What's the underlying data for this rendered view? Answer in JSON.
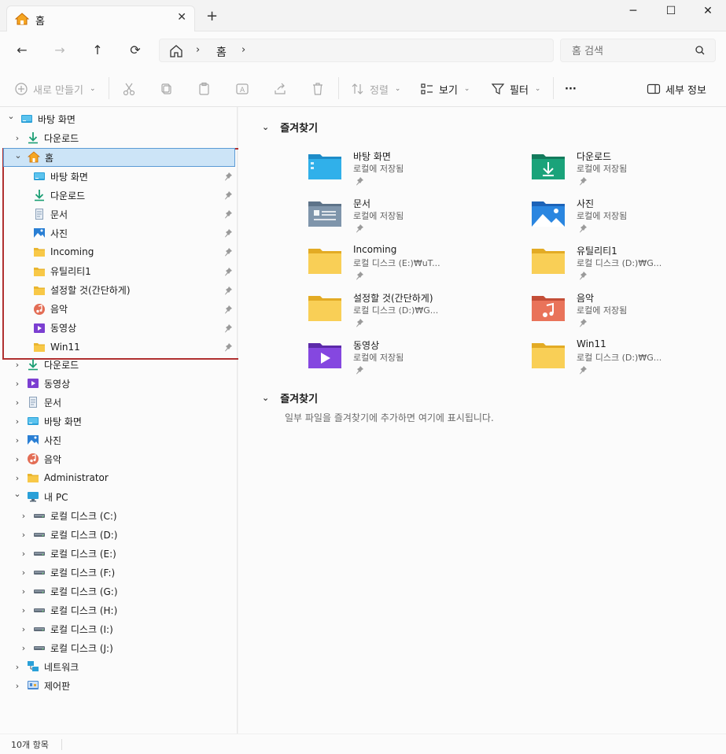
{
  "tab": {
    "title": "홈",
    "close": "✕",
    "new_tab": "+"
  },
  "window": {
    "minimize": "─",
    "maximize": "☐",
    "close": "✕"
  },
  "nav": {
    "back": "←",
    "forward": "→",
    "up": "↑",
    "refresh": "⟳"
  },
  "address": {
    "segment": "홈",
    "chevron": "›"
  },
  "search": {
    "placeholder": "홈 검색"
  },
  "toolbar": {
    "new_label": "새로 만들기",
    "sort_label": "정렬",
    "view_label": "보기",
    "filter_label": "필터",
    "more_label": "···",
    "details_label": "세부 정보"
  },
  "sidebar": {
    "desktop_top": "바탕 화면",
    "downloads_top": "다운로드",
    "home": "홈",
    "home_children": [
      {
        "label": "바탕 화면",
        "icon": "desktop-icon"
      },
      {
        "label": "다운로드",
        "icon": "download-icon"
      },
      {
        "label": "문서",
        "icon": "document-icon"
      },
      {
        "label": "사진",
        "icon": "pictures-icon"
      },
      {
        "label": "Incoming",
        "icon": "folder-icon"
      },
      {
        "label": "유틸리티1",
        "icon": "folder-icon"
      },
      {
        "label": "설정할 것(간단하게)",
        "icon": "folder-icon"
      },
      {
        "label": "음악",
        "icon": "music-icon"
      },
      {
        "label": "동영상",
        "icon": "video-icon"
      },
      {
        "label": "Win11",
        "icon": "folder-icon"
      }
    ],
    "libraries": [
      {
        "label": "다운로드",
        "icon": "download-icon"
      },
      {
        "label": "동영상",
        "icon": "video-icon"
      },
      {
        "label": "문서",
        "icon": "document-icon"
      },
      {
        "label": "바탕 화면",
        "icon": "desktop-icon"
      },
      {
        "label": "사진",
        "icon": "pictures-icon"
      },
      {
        "label": "음악",
        "icon": "music-icon"
      },
      {
        "label": "Administrator",
        "icon": "folder-icon"
      }
    ],
    "pc": "내 PC",
    "drives": [
      "로컬 디스크 (C:)",
      "로컬 디스크 (D:)",
      "로컬 디스크 (E:)",
      "로컬 디스크 (F:)",
      "로컬 디스크 (G:)",
      "로컬 디스크 (H:)",
      "로컬 디스크 (I:)",
      "로컬 디스크 (J:)"
    ],
    "network": "네트워크",
    "control_panel": "제어판"
  },
  "main": {
    "section1": "즐겨찾기",
    "section2": "즐겨찾기",
    "empty_message": "일부 파일을 즐겨찾기에 추가하면 여기에 표시됩니다.",
    "favorites": [
      {
        "name": "바탕 화면",
        "location": "로컬에 저장됨",
        "icon": "desktop-folder-icon"
      },
      {
        "name": "다운로드",
        "location": "로컬에 저장됨",
        "icon": "download-folder-icon"
      },
      {
        "name": "문서",
        "location": "로컬에 저장됨",
        "icon": "document-folder-icon"
      },
      {
        "name": "사진",
        "location": "로컬에 저장됨",
        "icon": "pictures-folder-icon"
      },
      {
        "name": "Incoming",
        "location": "로컬 디스크 (E:)₩uT...",
        "icon": "folder-icon"
      },
      {
        "name": "유틸리티1",
        "location": "로컬 디스크 (D:)₩G...",
        "icon": "folder-icon"
      },
      {
        "name": "설정할 것(간단하게)",
        "location": "로컬 디스크 (D:)₩G...",
        "icon": "folder-icon"
      },
      {
        "name": "음악",
        "location": "로컬에 저장됨",
        "icon": "music-folder-icon"
      },
      {
        "name": "동영상",
        "location": "로컬에 저장됨",
        "icon": "video-folder-icon"
      },
      {
        "name": "Win11",
        "location": "로컬 디스크 (D:)₩G...",
        "icon": "folder-icon"
      }
    ]
  },
  "status": {
    "item_count": "10개 항목"
  },
  "colors": {
    "accent": "#0067c0",
    "selection": "#cce4f7",
    "highlight_border": "#b03030",
    "folder_yellow": "#f8c847"
  }
}
